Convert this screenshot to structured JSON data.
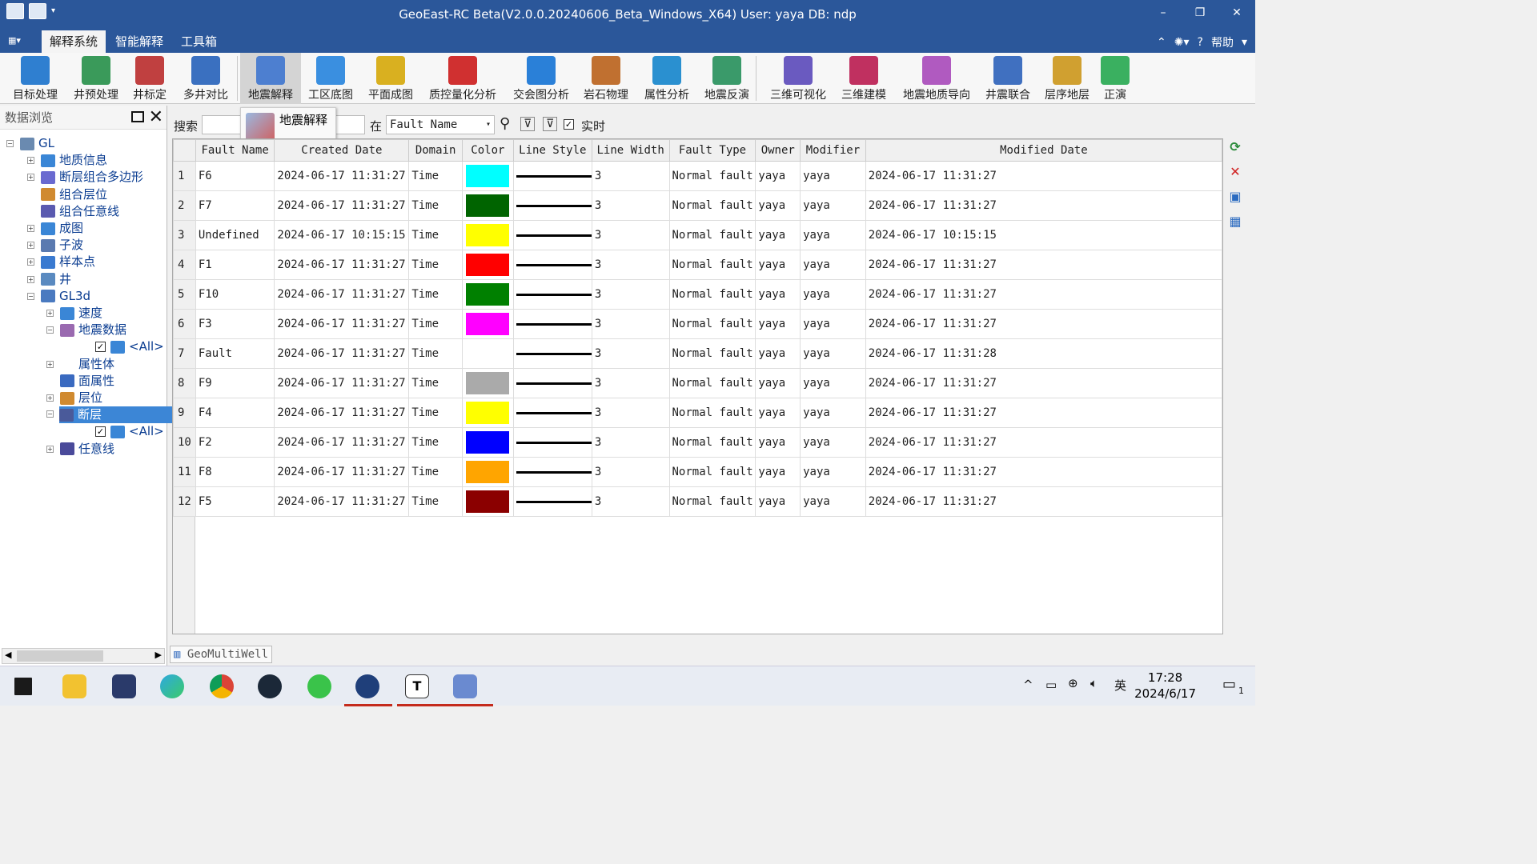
{
  "window": {
    "title": "GeoEast-RC Beta(V2.0.0.20240606_Beta_Windows_X64)  User: yaya   DB: ndp",
    "minimize": "–",
    "restore": "❐",
    "close": "✕"
  },
  "menubar": {
    "sys_button": "▦▾",
    "tabs": [
      "解释系统",
      "智能解释",
      "工具箱"
    ],
    "active_tab": "解释系统",
    "help": "帮助"
  },
  "ribbon": {
    "buttons": [
      {
        "label": "目标处理",
        "color": "#2f7fd0"
      },
      {
        "label": "井预处理",
        "color": "#3a9a5a"
      },
      {
        "label": "井标定",
        "color": "#c04040"
      },
      {
        "label": "多井对比",
        "color": "#3a70c0"
      },
      {
        "label": "地震解释",
        "color": "#4d7fd0"
      },
      {
        "label": "工区底图",
        "color": "#3a8fe0"
      },
      {
        "label": "平面成图",
        "color": "#d9b020"
      },
      {
        "label": "质控量化分析",
        "color": "#d03030"
      },
      {
        "label": "交会图分析",
        "color": "#2a80d8"
      },
      {
        "label": "岩石物理",
        "color": "#c07030"
      },
      {
        "label": "属性分析",
        "color": "#2a90d0"
      },
      {
        "label": "地震反演",
        "color": "#3a9a6a"
      },
      {
        "label": "三维可视化",
        "color": "#6a5ac0"
      },
      {
        "label": "三维建模",
        "color": "#c03060"
      },
      {
        "label": "地震地质导向",
        "color": "#b05ac0"
      },
      {
        "label": "井震联合",
        "color": "#4070c0"
      },
      {
        "label": "层序地层",
        "color": "#d0a030"
      },
      {
        "label": "正演",
        "color": "#3ab060"
      }
    ],
    "selected": "地震解释"
  },
  "left_panel": {
    "title": "数据浏览",
    "tree": [
      {
        "label": "GL",
        "level": 0,
        "expander": "−",
        "icon": "#6a8ab0"
      },
      {
        "label": "地质信息",
        "level": 1,
        "expander": "+",
        "icon": "#3a86d6"
      },
      {
        "label": "断层组合多边形",
        "level": 1,
        "expander": "+",
        "icon": "#6a6ad0"
      },
      {
        "label": "组合层位",
        "level": 1,
        "expander": "",
        "icon": "#d08a30"
      },
      {
        "label": "组合任意线",
        "level": 1,
        "expander": "",
        "icon": "#5a5ab0"
      },
      {
        "label": "成图",
        "level": 1,
        "expander": "+",
        "icon": "#3a86d6"
      },
      {
        "label": "子波",
        "level": 1,
        "expander": "+",
        "icon": "#5a7ab0"
      },
      {
        "label": "样本点",
        "level": 1,
        "expander": "+",
        "icon": "#3a7ad0"
      },
      {
        "label": "井",
        "level": 1,
        "expander": "+",
        "icon": "#5a8ac0"
      },
      {
        "label": "GL3d",
        "level": 1,
        "expander": "−",
        "icon": "#4a7ac0"
      },
      {
        "label": "速度",
        "level": 2,
        "expander": "+",
        "icon": "#3a86d6"
      },
      {
        "label": "地震数据",
        "level": 2,
        "expander": "−",
        "icon": "#9a6ab0"
      },
      {
        "label": "<All>",
        "level": 3,
        "expander": "",
        "icon": "#3a86d6",
        "checked": true
      },
      {
        "label": "属性体",
        "level": 2,
        "expander": "+",
        "icon": ""
      },
      {
        "label": "面属性",
        "level": 2,
        "expander": "",
        "icon": "#3a6ac0"
      },
      {
        "label": "层位",
        "level": 2,
        "expander": "+",
        "icon": "#d08a30"
      },
      {
        "label": "断层",
        "level": 2,
        "expander": "−",
        "icon": "#4a5a9a",
        "selected": true
      },
      {
        "label": "<All>",
        "level": 3,
        "expander": "",
        "icon": "#3a86d6",
        "checked": true
      },
      {
        "label": "任意线",
        "level": 2,
        "expander": "+",
        "icon": "#4a4a9a"
      }
    ]
  },
  "searchbar": {
    "search_label": "搜索",
    "in_label": "在",
    "field_value": "Fault Name",
    "realtime_label": "实时",
    "realtime_checked": true
  },
  "tooltip": {
    "text": "地震解释"
  },
  "table": {
    "columns": [
      "Fault Name",
      "Created Date",
      "Domain",
      "Color",
      "Line Style",
      "Line Width",
      "Fault Type",
      "Owner",
      "Modifier",
      "Modified Date"
    ],
    "rows": [
      {
        "n": "1",
        "name": "F6",
        "created": "2024-06-17 11:31:27",
        "domain": "Time",
        "color": "#00ffff",
        "width": "3",
        "type": "Normal fault",
        "owner": "yaya",
        "modifier": "yaya",
        "modified": "2024-06-17 11:31:27"
      },
      {
        "n": "2",
        "name": "F7",
        "created": "2024-06-17 11:31:27",
        "domain": "Time",
        "color": "#006400",
        "width": "3",
        "type": "Normal fault",
        "owner": "yaya",
        "modifier": "yaya",
        "modified": "2024-06-17 11:31:27"
      },
      {
        "n": "3",
        "name": "Undefined",
        "created": "2024-06-17 10:15:15",
        "domain": "Time",
        "color": "#ffff00",
        "width": "3",
        "type": "Normal fault",
        "owner": "yaya",
        "modifier": "yaya",
        "modified": "2024-06-17 10:15:15"
      },
      {
        "n": "4",
        "name": "F1",
        "created": "2024-06-17 11:31:27",
        "domain": "Time",
        "color": "#ff0000",
        "width": "3",
        "type": "Normal fault",
        "owner": "yaya",
        "modifier": "yaya",
        "modified": "2024-06-17 11:31:27"
      },
      {
        "n": "5",
        "name": "F10",
        "created": "2024-06-17 11:31:27",
        "domain": "Time",
        "color": "#008000",
        "width": "3",
        "type": "Normal fault",
        "owner": "yaya",
        "modifier": "yaya",
        "modified": "2024-06-17 11:31:27"
      },
      {
        "n": "6",
        "name": "F3",
        "created": "2024-06-17 11:31:27",
        "domain": "Time",
        "color": "#ff00ff",
        "width": "3",
        "type": "Normal fault",
        "owner": "yaya",
        "modifier": "yaya",
        "modified": "2024-06-17 11:31:27"
      },
      {
        "n": "7",
        "name": "Fault",
        "created": "2024-06-17 11:31:27",
        "domain": "Time",
        "color": "#ffffff",
        "width": "3",
        "type": "Normal fault",
        "owner": "yaya",
        "modifier": "yaya",
        "modified": "2024-06-17 11:31:28"
      },
      {
        "n": "8",
        "name": "F9",
        "created": "2024-06-17 11:31:27",
        "domain": "Time",
        "color": "#aaaaaa",
        "width": "3",
        "type": "Normal fault",
        "owner": "yaya",
        "modifier": "yaya",
        "modified": "2024-06-17 11:31:27"
      },
      {
        "n": "9",
        "name": "F4",
        "created": "2024-06-17 11:31:27",
        "domain": "Time",
        "color": "#ffff00",
        "width": "3",
        "type": "Normal fault",
        "owner": "yaya",
        "modifier": "yaya",
        "modified": "2024-06-17 11:31:27"
      },
      {
        "n": "10",
        "name": "F2",
        "created": "2024-06-17 11:31:27",
        "domain": "Time",
        "color": "#0000ff",
        "width": "3",
        "type": "Normal fault",
        "owner": "yaya",
        "modifier": "yaya",
        "modified": "2024-06-17 11:31:27"
      },
      {
        "n": "11",
        "name": "F8",
        "created": "2024-06-17 11:31:27",
        "domain": "Time",
        "color": "#ffa500",
        "width": "3",
        "type": "Normal fault",
        "owner": "yaya",
        "modifier": "yaya",
        "modified": "2024-06-17 11:31:27"
      },
      {
        "n": "12",
        "name": "F5",
        "created": "2024-06-17 11:31:27",
        "domain": "Time",
        "color": "#8b0000",
        "width": "3",
        "type": "Normal fault",
        "owner": "yaya",
        "modifier": "yaya",
        "modified": "2024-06-17 11:31:27"
      }
    ]
  },
  "side_tools": [
    {
      "name": "refresh-icon",
      "glyph": "⟳",
      "color": "#2a8a3a"
    },
    {
      "name": "delete-icon",
      "glyph": "✕",
      "color": "#d02020"
    },
    {
      "name": "save-icon",
      "glyph": "▣",
      "color": "#2a6ac0"
    },
    {
      "name": "table-settings-icon",
      "glyph": "▦",
      "color": "#2a6ac0"
    }
  ],
  "statusbar": {
    "tab": "GeoMultiWell"
  },
  "taskbar": {
    "time": "17:28",
    "date": "2024/6/17",
    "ime": "英",
    "notification_count": "1",
    "apps": [
      "start",
      "file-explorer",
      "cat-app",
      "edge",
      "chrome",
      "steam",
      "wechat",
      "geoeast",
      "typora",
      "geomultiwell"
    ]
  }
}
